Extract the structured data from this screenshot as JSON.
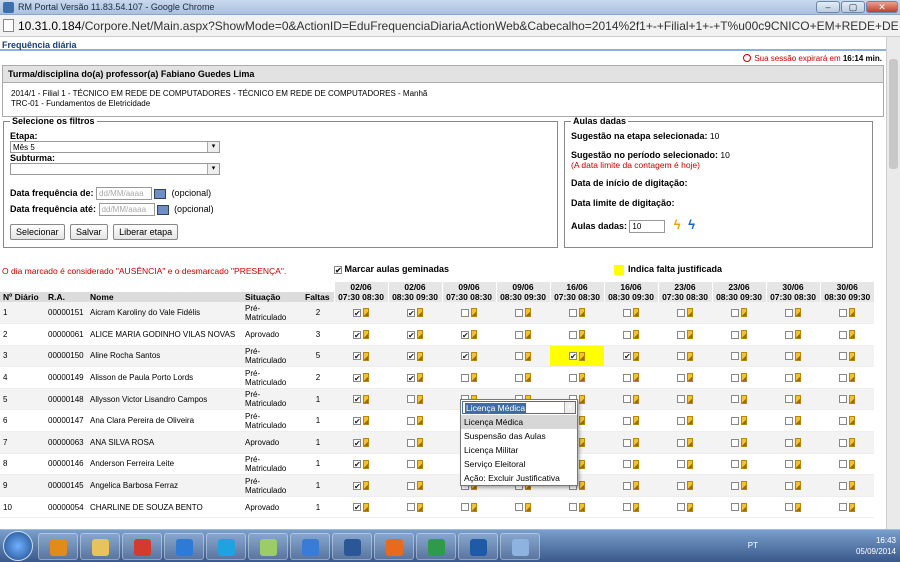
{
  "window": {
    "title": "RM Portal Versão 11.83.54.107 - Google Chrome",
    "min": "–",
    "max": "▢",
    "close": "✕"
  },
  "address": {
    "url_host": "10.31.0.184",
    "url_path": "/Corpore.Net/Main.aspx?ShowMode=0&ActionID=EduFrequenciaDiariaActionWeb&Cabecalho=2014%2f1+-+Filial+1+-+T%u00c9CNICO+EM+REDE+DE+COMPUTADO"
  },
  "page": {
    "title": "Frequência diária",
    "session_text": "Sua sessão expirará em",
    "session_time": "16:14",
    "session_unit": "min."
  },
  "teacher_panel": {
    "header": "Turma/disciplina do(a) professor(a) Fabiano Guedes Lima",
    "line1": "2014/1 - Filial 1 - TÉCNICO EM REDE DE COMPUTADORES - TÉCNICO EM REDE DE COMPUTADORES - Manhã",
    "line2": "TRC-01 - Fundamentos de Eletricidade"
  },
  "filters": {
    "legend": "Selecione os filtros",
    "etapa_label": "Etapa:",
    "etapa_value": "Mês 5",
    "subturma_label": "Subturma:",
    "subturma_value": "",
    "data_de_label": "Data frequência de:",
    "data_ate_label": "Data frequência até:",
    "date_placeholder": "dd/MM/aaaa",
    "optional": "(opcional)",
    "btn_select": "Selecionar",
    "btn_save": "Salvar",
    "btn_release": "Liberar etapa"
  },
  "aulas": {
    "legend": "Aulas dadas",
    "sug_etapa_label": "Sugestão na etapa selecionada:",
    "sug_etapa_value": "10",
    "sug_periodo_label": "Sugestão no período selecionado:",
    "sug_periodo_value": "10",
    "sug_periodo_note": "(A data limite da contagem é hoje)",
    "inicio_label": "Data de início de digitação:",
    "limite_label": "Data limite de digitação:",
    "dadas_label": "Aulas dadas:",
    "dadas_value": "10"
  },
  "notes": {
    "legend_text": "O dia marcado é considerado \"AUSÊNCIA\" e o desmarcado \"PRESENÇA\".",
    "geminadas": "Marcar aulas geminadas",
    "justificada": "Indica falta justificada",
    "accent_yellow": "#ffff00"
  },
  "table": {
    "headers": {
      "num": "Nº Diário",
      "ra": "R.A.",
      "nome": "Nome",
      "situacao": "Situação",
      "faltas": "Faltas"
    },
    "dates": [
      "02/06",
      "02/06",
      "09/06",
      "09/06",
      "16/06",
      "16/06",
      "23/06",
      "23/06",
      "30/06",
      "30/06"
    ],
    "times": [
      "07:30 08:30",
      "08:30 09:30",
      "07:30 08:30",
      "08:30 09:30",
      "07:30 08:30",
      "08:30 09:30",
      "07:30 08:30",
      "08:30 09:30",
      "07:30 08:30",
      "08:30 09:30"
    ],
    "rows": [
      {
        "num": "1",
        "ra": "00000151",
        "nome": "Aicram Karoliny do Vale Fidélis",
        "sit1": "Pré-",
        "sit2": "Matriculado",
        "faltas": "2",
        "checks": [
          1,
          1,
          0,
          0,
          0,
          0,
          0,
          0,
          0,
          0
        ]
      },
      {
        "num": "2",
        "ra": "00000061",
        "nome": "ALICE MARIA GODINHO VILAS NOVAS",
        "sit1": "Aprovado",
        "sit2": "",
        "faltas": "3",
        "checks": [
          1,
          1,
          1,
          0,
          0,
          0,
          0,
          0,
          0,
          0
        ]
      },
      {
        "num": "3",
        "ra": "00000150",
        "nome": "Aline Rocha Santos",
        "sit1": "Pré-",
        "sit2": "Matriculado",
        "faltas": "5",
        "checks": [
          1,
          1,
          1,
          0,
          1,
          1,
          0,
          0,
          0,
          0
        ]
      },
      {
        "num": "4",
        "ra": "00000149",
        "nome": "Alisson de Paula Porto Lords",
        "sit1": "Pré-",
        "sit2": "Matriculado",
        "faltas": "2",
        "checks": [
          1,
          1,
          0,
          0,
          0,
          0,
          0,
          0,
          0,
          0
        ]
      },
      {
        "num": "5",
        "ra": "00000148",
        "nome": "Allysson Victor Lisandro Campos",
        "sit1": "Pré-",
        "sit2": "Matriculado",
        "faltas": "1",
        "checks": [
          1,
          0,
          0,
          0,
          0,
          0,
          0,
          0,
          0,
          0
        ]
      },
      {
        "num": "6",
        "ra": "00000147",
        "nome": "Ana Clara Pereira de Oliveira",
        "sit1": "Pré-",
        "sit2": "Matriculado",
        "faltas": "1",
        "checks": [
          1,
          0,
          0,
          0,
          0,
          0,
          0,
          0,
          0,
          0
        ]
      },
      {
        "num": "7",
        "ra": "00000063",
        "nome": "ANA SILVA ROSA",
        "sit1": "Aprovado",
        "sit2": "",
        "faltas": "1",
        "checks": [
          1,
          0,
          0,
          0,
          0,
          0,
          0,
          0,
          0,
          0
        ]
      },
      {
        "num": "8",
        "ra": "00000146",
        "nome": "Anderson Ferreira Leite",
        "sit1": "Pré-",
        "sit2": "Matriculado",
        "faltas": "1",
        "checks": [
          1,
          0,
          0,
          0,
          0,
          0,
          0,
          0,
          0,
          0
        ]
      },
      {
        "num": "9",
        "ra": "00000145",
        "nome": "Angelica Barbosa Ferraz",
        "sit1": "Pré-",
        "sit2": "Matriculado",
        "faltas": "1",
        "checks": [
          1,
          0,
          0,
          0,
          0,
          0,
          0,
          0,
          0,
          0
        ]
      },
      {
        "num": "10",
        "ra": "00000054",
        "nome": "CHARLINE DE SOUZA BENTO",
        "sit1": "Aprovado",
        "sit2": "",
        "faltas": "1",
        "checks": [
          1,
          0,
          0,
          0,
          0,
          0,
          0,
          0,
          0,
          0
        ]
      }
    ]
  },
  "dropdown": {
    "selected": "Licença Médica",
    "items": [
      "Licença Médica",
      "Suspensão das Aulas",
      "Licença Militar",
      "Serviço Eleitoral",
      "Ação: Excluir Justificativa"
    ]
  },
  "taskbar": {
    "lang": "PT",
    "time": "16:43",
    "date": "05/09/2014",
    "apps": [
      {
        "icon": "outlook-icon",
        "color": "#e38b1a"
      },
      {
        "icon": "explorer-icon",
        "color": "#e8c25a"
      },
      {
        "icon": "chrome-icon",
        "color": "#d33b2c"
      },
      {
        "icon": "ie-icon",
        "color": "#2d7bd6"
      },
      {
        "icon": "skype-icon",
        "color": "#1fa3e0"
      },
      {
        "icon": "folder-icon",
        "color": "#9ccc65"
      },
      {
        "icon": "remote-icon",
        "color": "#3a7bd5"
      },
      {
        "icon": "word-icon",
        "color": "#2b5797"
      },
      {
        "icon": "pdf-icon",
        "color": "#e86a1d"
      },
      {
        "icon": "app-icon",
        "color": "#2e9a4a"
      },
      {
        "icon": "vm-icon",
        "color": "#1e5aa8"
      },
      {
        "icon": "calc-icon",
        "color": "#8fb3e0"
      }
    ]
  }
}
